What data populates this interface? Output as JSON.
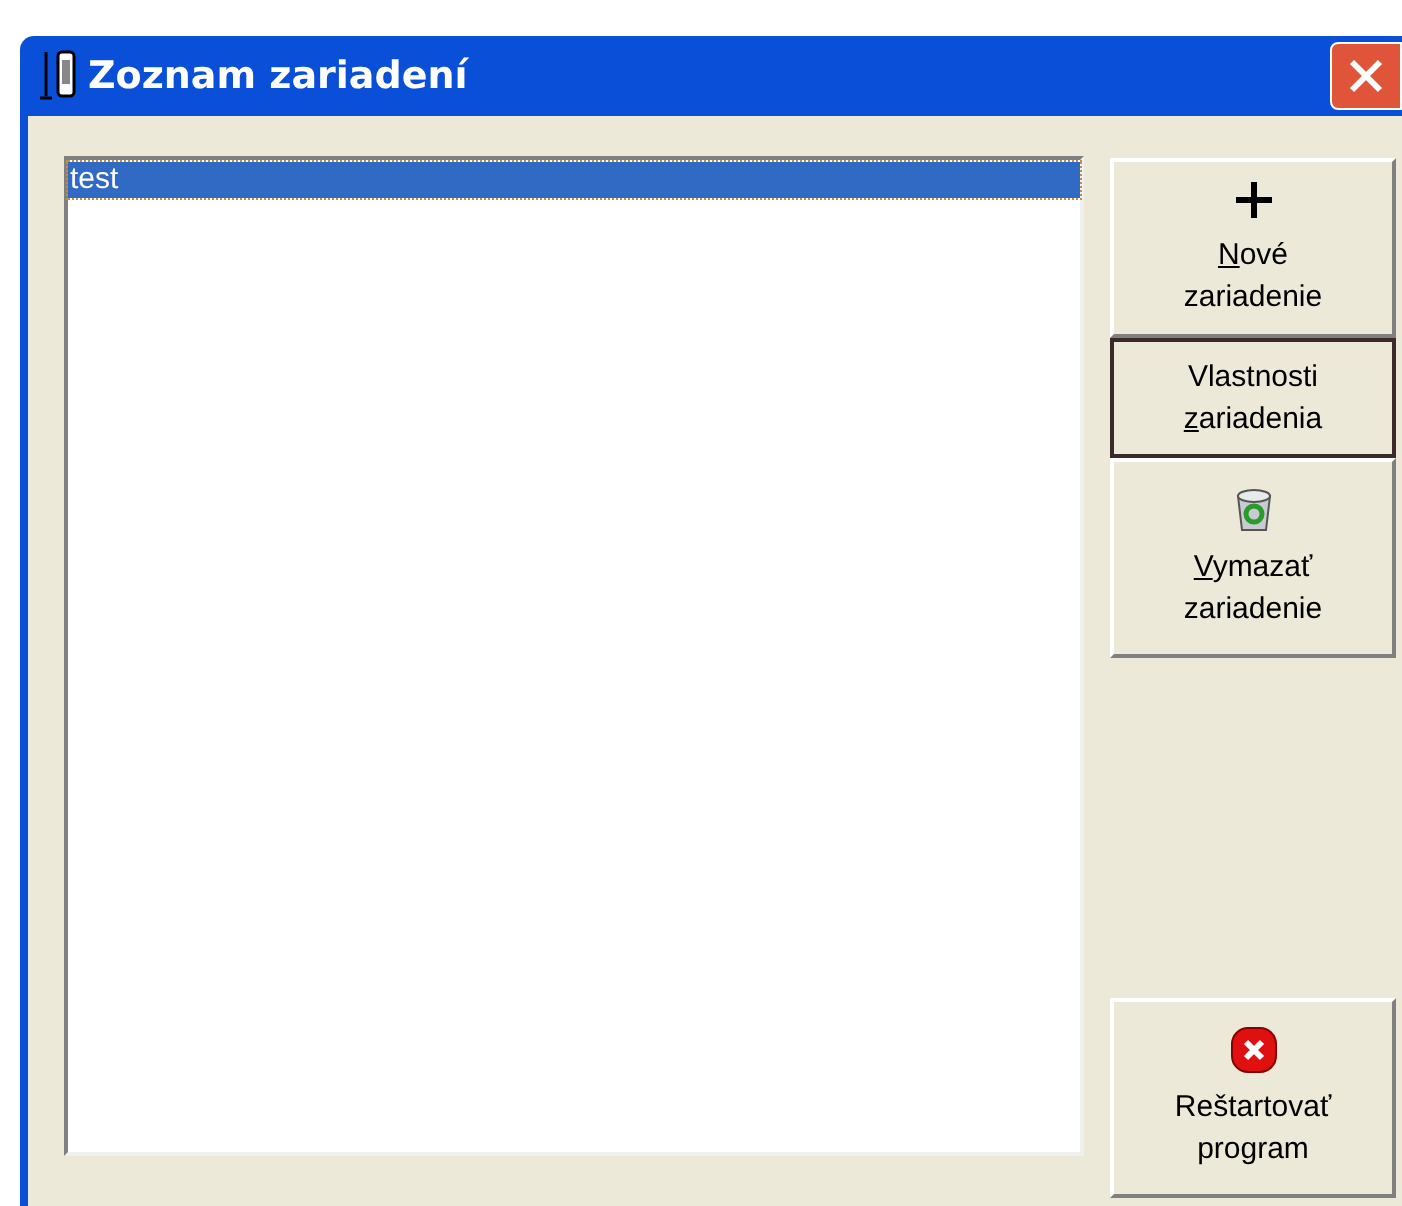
{
  "window": {
    "title": "Zoznam zariadení"
  },
  "list": {
    "items": [
      {
        "label": "test",
        "selected": true
      }
    ]
  },
  "buttons": [
    {
      "kind": "add",
      "focused": false,
      "lines": [
        [
          {
            "text": "N",
            "underline": true
          },
          {
            "text": "ové",
            "underline": false
          }
        ],
        [
          {
            "text": "zariadenie",
            "underline": false
          }
        ]
      ]
    },
    {
      "kind": "text",
      "focused": true,
      "lines": [
        [
          {
            "text": "Vlastnosti",
            "underline": false
          }
        ],
        [
          {
            "text": "z",
            "underline": true
          },
          {
            "text": "ariadenia",
            "underline": false
          }
        ]
      ]
    },
    {
      "kind": "delete",
      "focused": false,
      "lines": [
        [
          {
            "text": "V",
            "underline": true
          },
          {
            "text": "ymazať",
            "underline": false
          }
        ],
        [
          {
            "text": "zariadenie",
            "underline": false
          }
        ]
      ]
    },
    {
      "kind": "restart",
      "focused": false,
      "lines": [
        [
          {
            "text": "Reštartovať",
            "underline": false
          }
        ],
        [
          {
            "text": "program",
            "underline": false
          }
        ]
      ]
    }
  ]
}
